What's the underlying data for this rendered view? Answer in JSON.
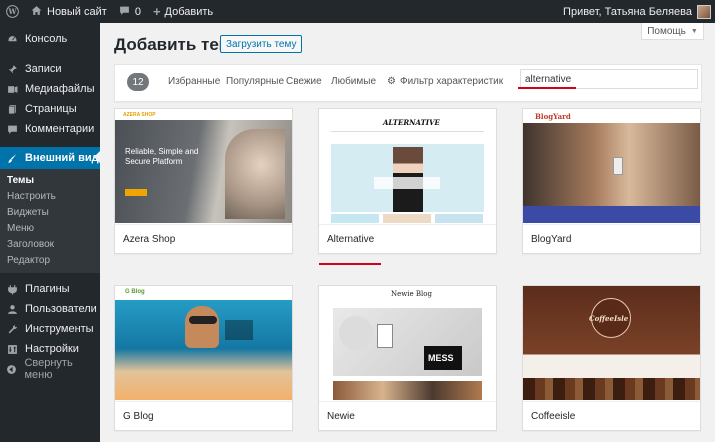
{
  "adminbar": {
    "site_name": "Новый сайт",
    "comments_count": "0",
    "add_label": "Добавить",
    "greeting": "Привет, Татьяна Беляева"
  },
  "sidebar": {
    "items": [
      {
        "label": "Консоль",
        "icon": "dashboard-icon"
      },
      {
        "label": "Записи",
        "icon": "posts-icon"
      },
      {
        "label": "Медиафайлы",
        "icon": "media-icon"
      },
      {
        "label": "Страницы",
        "icon": "pages-icon"
      },
      {
        "label": "Комментарии",
        "icon": "comments-icon"
      },
      {
        "label": "Внешний вид",
        "icon": "appearance-icon"
      }
    ],
    "appearance_sub": [
      "Темы",
      "Настроить",
      "Виджеты",
      "Меню",
      "Заголовок",
      "Редактор"
    ],
    "items_after": [
      {
        "label": "Плагины",
        "icon": "plugins-icon"
      },
      {
        "label": "Пользователи",
        "icon": "users-icon"
      },
      {
        "label": "Инструменты",
        "icon": "tools-icon"
      },
      {
        "label": "Настройки",
        "icon": "settings-icon"
      },
      {
        "label": "Свернуть меню",
        "icon": "collapse-icon"
      }
    ]
  },
  "header": {
    "help_label": "Помощь",
    "title": "Добавить темы",
    "upload_label": "Загрузить тему"
  },
  "filter": {
    "count": "12",
    "tabs": [
      "Избранные",
      "Популярные",
      "Свежие",
      "Любимые"
    ],
    "feature_filter": "Фильтр характеристик",
    "search_value": "alternative"
  },
  "themes": [
    {
      "name": "Azera Shop",
      "headline": "Reliable, Simple and Secure Platform",
      "logo": "AZERA SHOP"
    },
    {
      "name": "Alternative",
      "logo": "ALTERNATIVE"
    },
    {
      "name": "BlogYard",
      "logo": "BlogYard"
    },
    {
      "name": "G Blog",
      "logo": "G Blog"
    },
    {
      "name": "Newie",
      "logo": "Newie Blog",
      "sign": "MESS"
    },
    {
      "name": "Coffeeisle",
      "logo": "CoffeeIsle"
    }
  ],
  "colors": {
    "admin_dark": "#23282d",
    "accent": "#0073aa",
    "highlight": "#d0021b"
  }
}
